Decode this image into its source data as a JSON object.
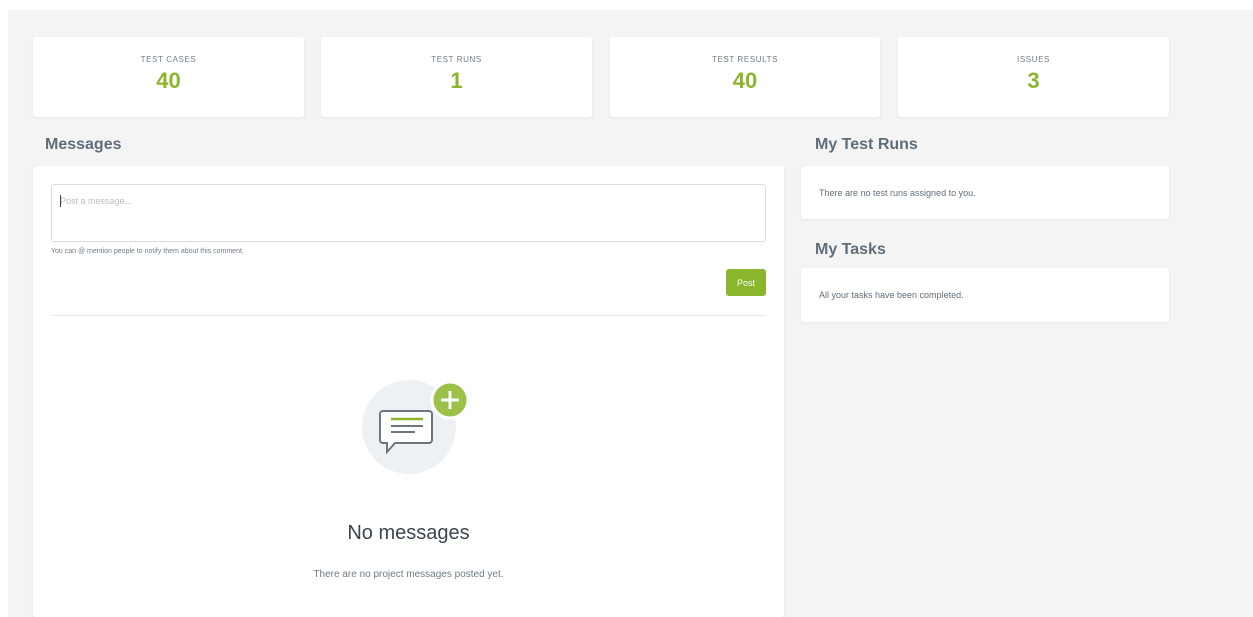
{
  "stats": [
    {
      "label": "TEST CASES",
      "value": "40"
    },
    {
      "label": "TEST RUNS",
      "value": "1"
    },
    {
      "label": "TEST RESULTS",
      "value": "40"
    },
    {
      "label": "ISSUES",
      "value": "3"
    }
  ],
  "messages": {
    "title": "Messages",
    "input_placeholder": "Post a message...",
    "hint": "You can @ mention people to notify them about this comment.",
    "post_label": "Post",
    "empty_title": "No messages",
    "empty_subtitle": "There are no project messages posted yet.",
    "empty_icon": "chat-bubble-plus-icon"
  },
  "my_test_runs": {
    "title": "My Test Runs",
    "empty_text": "There are no test runs assigned to you."
  },
  "my_tasks": {
    "title": "My Tasks",
    "empty_text": "All your tasks have been completed."
  },
  "colors": {
    "accent": "#8ab62e",
    "background": "#f4f4f4",
    "heading": "#5f6e7b"
  }
}
